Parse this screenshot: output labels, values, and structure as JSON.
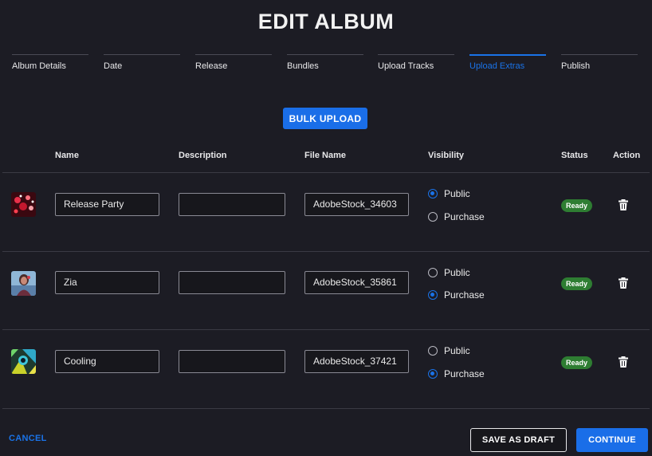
{
  "title": "EDIT ALBUM",
  "steps": [
    {
      "label": "Album Details",
      "active": false
    },
    {
      "label": "Date",
      "active": false
    },
    {
      "label": "Release",
      "active": false
    },
    {
      "label": "Bundles",
      "active": false
    },
    {
      "label": "Upload Tracks",
      "active": false
    },
    {
      "label": "Upload Extras",
      "active": true
    },
    {
      "label": "Publish",
      "active": false
    }
  ],
  "bulk_upload_label": "BULK UPLOAD",
  "columns": {
    "name": "Name",
    "description": "Description",
    "file_name": "File Name",
    "visibility": "Visibility",
    "status": "Status",
    "action": "Action"
  },
  "visibility_options": [
    "Public",
    "Purchase"
  ],
  "rows": [
    {
      "thumbnail_icon": "party-thumbnail",
      "name": "Release Party",
      "description": "",
      "file_name": "AdobeStock_34603",
      "visibility": "Public",
      "status": "Ready"
    },
    {
      "thumbnail_icon": "portrait-thumbnail",
      "name": "Zia",
      "description": "",
      "file_name": "AdobeStock_35861",
      "visibility": "Purchase",
      "status": "Ready"
    },
    {
      "thumbnail_icon": "abstract-thumbnail",
      "name": "Cooling",
      "description": "",
      "file_name": "AdobeStock_37421",
      "visibility": "Purchase",
      "status": "Ready"
    }
  ],
  "footer": {
    "cancel_label": "CANCEL",
    "save_draft_label": "SAVE AS DRAFT",
    "continue_label": "CONTINUE"
  },
  "colors": {
    "background": "#1c1c24",
    "accent": "#1a73e8",
    "status_ready": "#2e7d32"
  }
}
